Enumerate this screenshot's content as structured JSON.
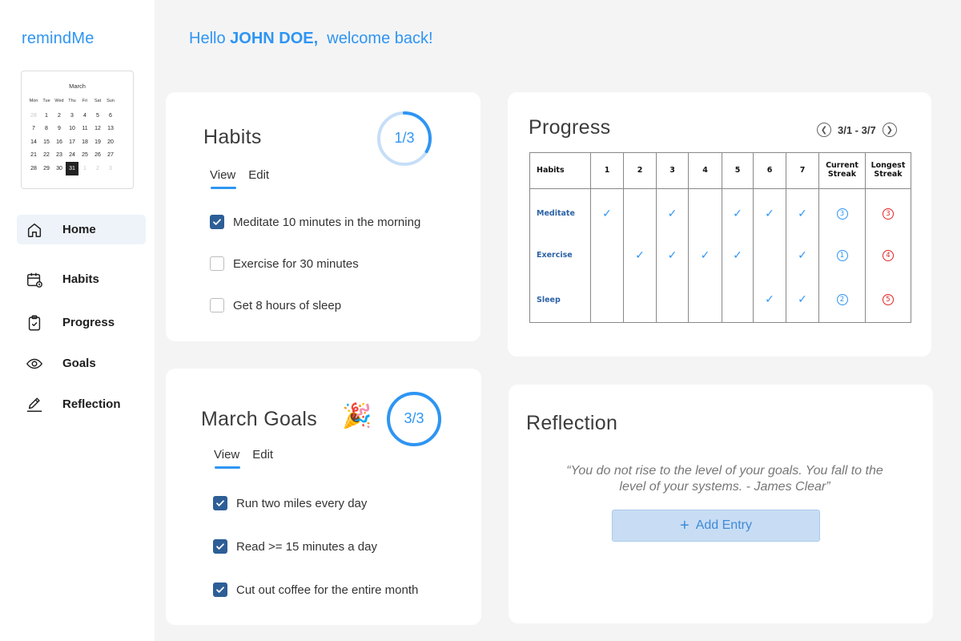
{
  "app": {
    "brand": "remindMe"
  },
  "greeting": {
    "prefix": "Hello",
    "name": "JOHN DOE,",
    "suffix": "welcome back!"
  },
  "calendar": {
    "month": "March",
    "weekdays": [
      "Mon",
      "Tue",
      "Wed",
      "Thu",
      "Fri",
      "Sat",
      "Sun"
    ],
    "days": [
      {
        "d": "28",
        "muted": true
      },
      {
        "d": "1"
      },
      {
        "d": "2"
      },
      {
        "d": "3"
      },
      {
        "d": "4"
      },
      {
        "d": "5"
      },
      {
        "d": "6"
      },
      {
        "d": "7"
      },
      {
        "d": "8"
      },
      {
        "d": "9"
      },
      {
        "d": "10"
      },
      {
        "d": "11"
      },
      {
        "d": "12"
      },
      {
        "d": "13"
      },
      {
        "d": "14"
      },
      {
        "d": "15"
      },
      {
        "d": "16"
      },
      {
        "d": "17"
      },
      {
        "d": "18"
      },
      {
        "d": "19"
      },
      {
        "d": "20"
      },
      {
        "d": "21"
      },
      {
        "d": "22"
      },
      {
        "d": "23"
      },
      {
        "d": "24"
      },
      {
        "d": "25"
      },
      {
        "d": "26"
      },
      {
        "d": "27"
      },
      {
        "d": "28"
      },
      {
        "d": "29"
      },
      {
        "d": "30"
      },
      {
        "d": "31",
        "selected": true
      },
      {
        "d": "1",
        "muted": true
      },
      {
        "d": "2",
        "muted": true
      },
      {
        "d": "3",
        "muted": true
      }
    ]
  },
  "nav": [
    {
      "label": "Home",
      "icon": "home-icon",
      "active": true
    },
    {
      "label": "Habits",
      "icon": "calendar-icon"
    },
    {
      "label": "Progress",
      "icon": "clipboard-check-icon"
    },
    {
      "label": "Goals",
      "icon": "eye-icon"
    },
    {
      "label": "Reflection",
      "icon": "pencil-icon"
    }
  ],
  "habits": {
    "title": "Habits",
    "score": "1/3",
    "fraction": 0.3333,
    "tabs": {
      "view": "View",
      "edit": "Edit"
    },
    "items": [
      {
        "label": "Meditate 10 minutes in the morning",
        "checked": true
      },
      {
        "label": "Exercise for 30 minutes",
        "checked": false
      },
      {
        "label": "Get 8 hours of sleep",
        "checked": false
      }
    ]
  },
  "goals": {
    "title": "March Goals",
    "emoji": "🎉",
    "score": "3/3",
    "fraction": 1,
    "tabs": {
      "view": "View",
      "edit": "Edit"
    },
    "items": [
      {
        "label": "Run two miles every day",
        "checked": true
      },
      {
        "label": "Read >= 15 minutes a day",
        "checked": true
      },
      {
        "label": "Cut out coffee for the entire month",
        "checked": true
      }
    ]
  },
  "progress": {
    "title": "Progress",
    "range": "3/1 - 3/7",
    "headers": {
      "habit": "Habits",
      "days": [
        "1",
        "2",
        "3",
        "4",
        "5",
        "6",
        "7"
      ],
      "current": "Current Streak",
      "longest": "Longest Streak"
    },
    "rows": [
      {
        "habit": "Meditate",
        "days": [
          true,
          false,
          true,
          false,
          true,
          true,
          true
        ],
        "current": "3",
        "longest": "3"
      },
      {
        "habit": "Exercise",
        "days": [
          false,
          true,
          true,
          true,
          true,
          false,
          true
        ],
        "current": "1",
        "longest": "4"
      },
      {
        "habit": "Sleep",
        "days": [
          false,
          false,
          false,
          false,
          false,
          true,
          true
        ],
        "current": "2",
        "longest": "5"
      }
    ]
  },
  "reflection": {
    "title": "Reflection",
    "quote": "“You do not rise to the level of your goals. You fall to the level of your systems. - James Clear”",
    "add_label": "Add Entry"
  },
  "colors": {
    "accent": "#2e95f3",
    "check": "#2d5e96",
    "red": "#e02424"
  }
}
